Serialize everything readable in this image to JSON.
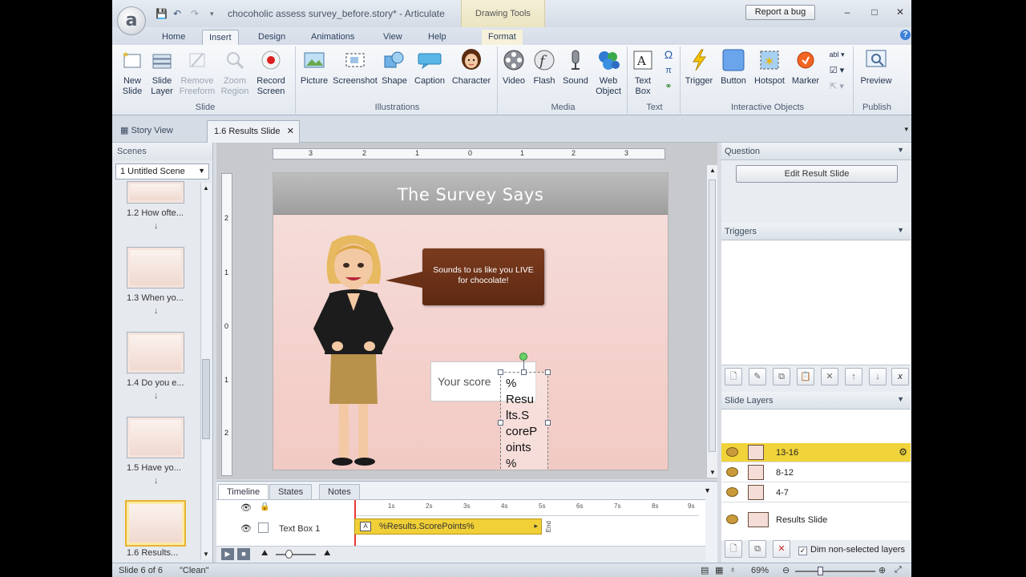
{
  "titlebar": {
    "doc_title": "chocoholic assess survey_before.story* - Articulate",
    "drawing_tools": "Drawing Tools",
    "report_bug": "Report a bug",
    "logo": "a"
  },
  "tabs": [
    "Home",
    "Insert",
    "Design",
    "Animations",
    "View",
    "Help"
  ],
  "format_tab": "Format",
  "ribbon": {
    "slide": {
      "label": "Slide",
      "buttons": [
        "New Slide",
        "Slide Layer",
        "Remove Freeform",
        "Zoom Region",
        "Record Screen"
      ]
    },
    "illustrations": {
      "label": "Illustrations",
      "buttons": [
        "Picture",
        "Screenshot",
        "Shape",
        "Caption",
        "Character"
      ]
    },
    "media": {
      "label": "Media",
      "buttons": [
        "Video",
        "Flash",
        "Sound",
        "Web Object"
      ]
    },
    "text": {
      "label": "Text",
      "buttons": [
        "Text Box"
      ]
    },
    "interactive": {
      "label": "Interactive Objects",
      "buttons": [
        "Trigger",
        "Button",
        "Hotspot",
        "Marker"
      ]
    },
    "publish": {
      "label": "Publish",
      "buttons": [
        "Preview"
      ]
    }
  },
  "view_tabs": {
    "story_view": "Story View",
    "results": "1.6 Results Slide"
  },
  "scenes": {
    "header": "Scenes",
    "selected": "1 Untitled Scene",
    "thumbs": [
      "1.2 How ofte...",
      "1.3 When yo...",
      "1.4 Do you e...",
      "1.5 Have yo...",
      "1.6 Results..."
    ]
  },
  "slide": {
    "title": "The Survey Says",
    "speech": "Sounds to us like you LIVE for chocolate!",
    "score_label": "Your score",
    "results_text": "%Results.ScorePoints%",
    "results_wrapped": [
      "%",
      "Resu",
      "lts.S",
      "coreP",
      "oints",
      "%"
    ]
  },
  "ruler": {
    "h": [
      "3",
      "2",
      "1",
      "0",
      "1",
      "2",
      "3"
    ],
    "v": [
      "2",
      "1",
      "0",
      "1",
      "2"
    ]
  },
  "right": {
    "question": "Question",
    "edit_result": "Edit Result Slide",
    "triggers": "Triggers",
    "slide_layers": "Slide Layers",
    "layers": [
      "13-16",
      "8-12",
      "4-7",
      "Results Slide"
    ],
    "dim_label": "Dim non-selected layers",
    "dim_checked": "✓"
  },
  "timeline": {
    "tabs": [
      "Timeline",
      "States",
      "Notes"
    ],
    "row_label": "Text Box 1",
    "bar_label": "%Results.ScorePoints%",
    "end_label": "End",
    "ticks": [
      "1s",
      "2s",
      "3s",
      "4s",
      "5s",
      "6s",
      "7s",
      "8s",
      "9s"
    ]
  },
  "status": {
    "slide": "Slide 6 of 6",
    "state": "\"Clean\"",
    "zoom": "69%"
  },
  "colors": {
    "accent": "#f0cf37",
    "speech_bg": "#6b3118",
    "slide_bg": "#f4d6d1"
  }
}
